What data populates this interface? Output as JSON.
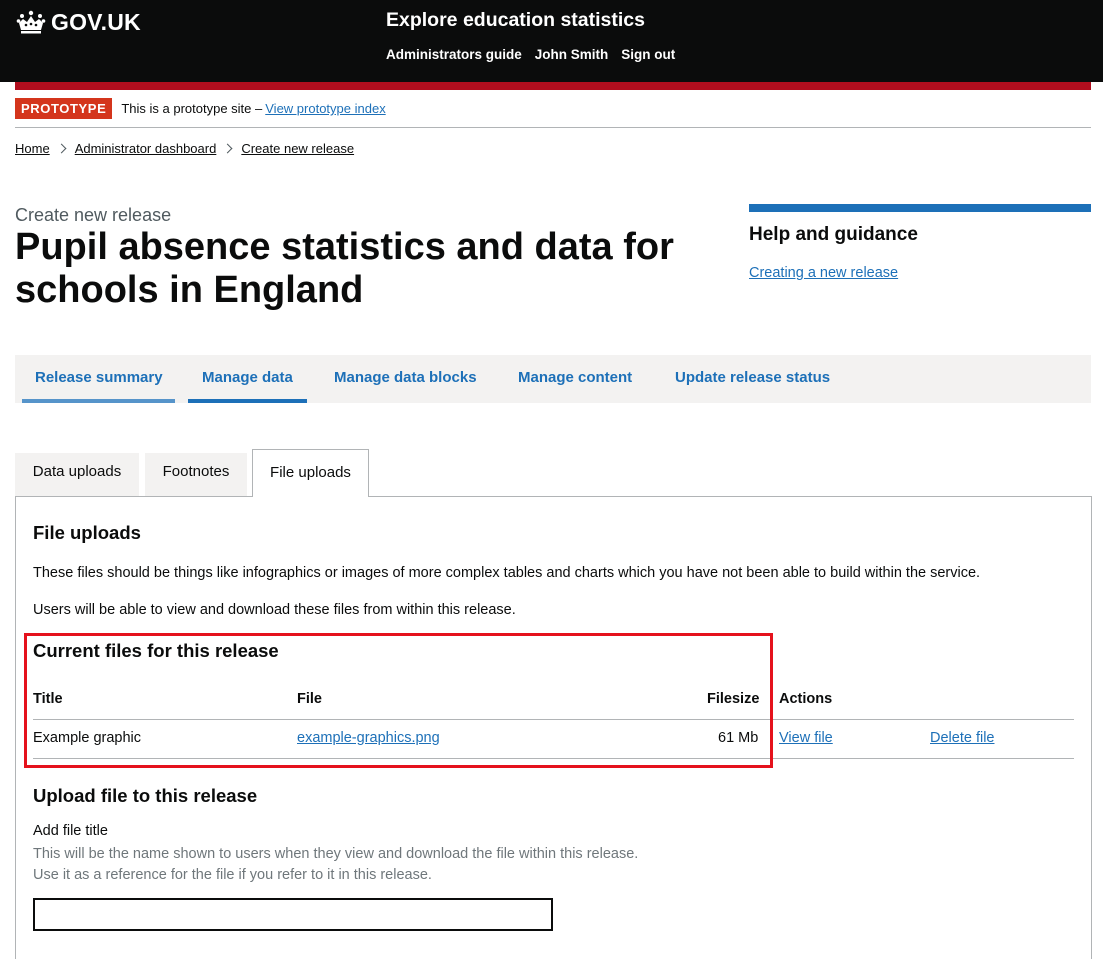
{
  "header": {
    "logo_text": "GOV.UK",
    "service_name": "Explore education statistics",
    "nav": [
      "Administrators guide",
      "John Smith",
      "Sign out"
    ],
    "colors": {
      "background": "#0b0c0c",
      "accent_bar": "#b10e1e"
    }
  },
  "banner": {
    "tag": "PROTOTYPE",
    "text": "This is a prototype site –",
    "link": "View prototype index"
  },
  "breadcrumb": [
    "Home",
    "Administrator dashboard",
    "Create new release"
  ],
  "page": {
    "caption": "Create new release",
    "title": "Pupil absence statistics and data for schools in England"
  },
  "help": {
    "title": "Help and guidance",
    "link": "Creating a new release"
  },
  "primary_nav": [
    {
      "label": "Release summary",
      "state": "visited"
    },
    {
      "label": "Manage data",
      "state": "current"
    },
    {
      "label": "Manage data blocks"
    },
    {
      "label": "Manage content"
    },
    {
      "label": "Update release status"
    }
  ],
  "tabs": [
    {
      "label": "Data uploads"
    },
    {
      "label": "Footnotes"
    },
    {
      "label": "File uploads",
      "selected": true
    }
  ],
  "panel": {
    "heading": "File uploads",
    "para1": "These files should be things like infographics or images of more complex tables and charts which you have not been able to build within the service.",
    "para2": "Users will be able to view and download these files from within this release.",
    "current_files": {
      "heading": "Current files for this release",
      "columns": [
        "Title",
        "File",
        "Filesize",
        "Actions"
      ],
      "rows": [
        {
          "title": "Example graphic",
          "file": "example-graphics.png",
          "filesize": "61 Mb",
          "actions": [
            "View file",
            "Delete file"
          ]
        }
      ]
    },
    "upload": {
      "heading": "Upload file to this release",
      "label": "Add file title",
      "hint_line1": "This will be the name shown to users when they view and download the file within this release.",
      "hint_line2": "Use it as a reference for the file if you refer to it in this release.",
      "value": ""
    }
  },
  "colors": {
    "link": "#1d70b8",
    "prototype_tag": "#d4351c",
    "highlight_border": "#e5121c",
    "nav_visited_underline": "#5694ca",
    "nav_current_underline": "#1d70b8"
  }
}
